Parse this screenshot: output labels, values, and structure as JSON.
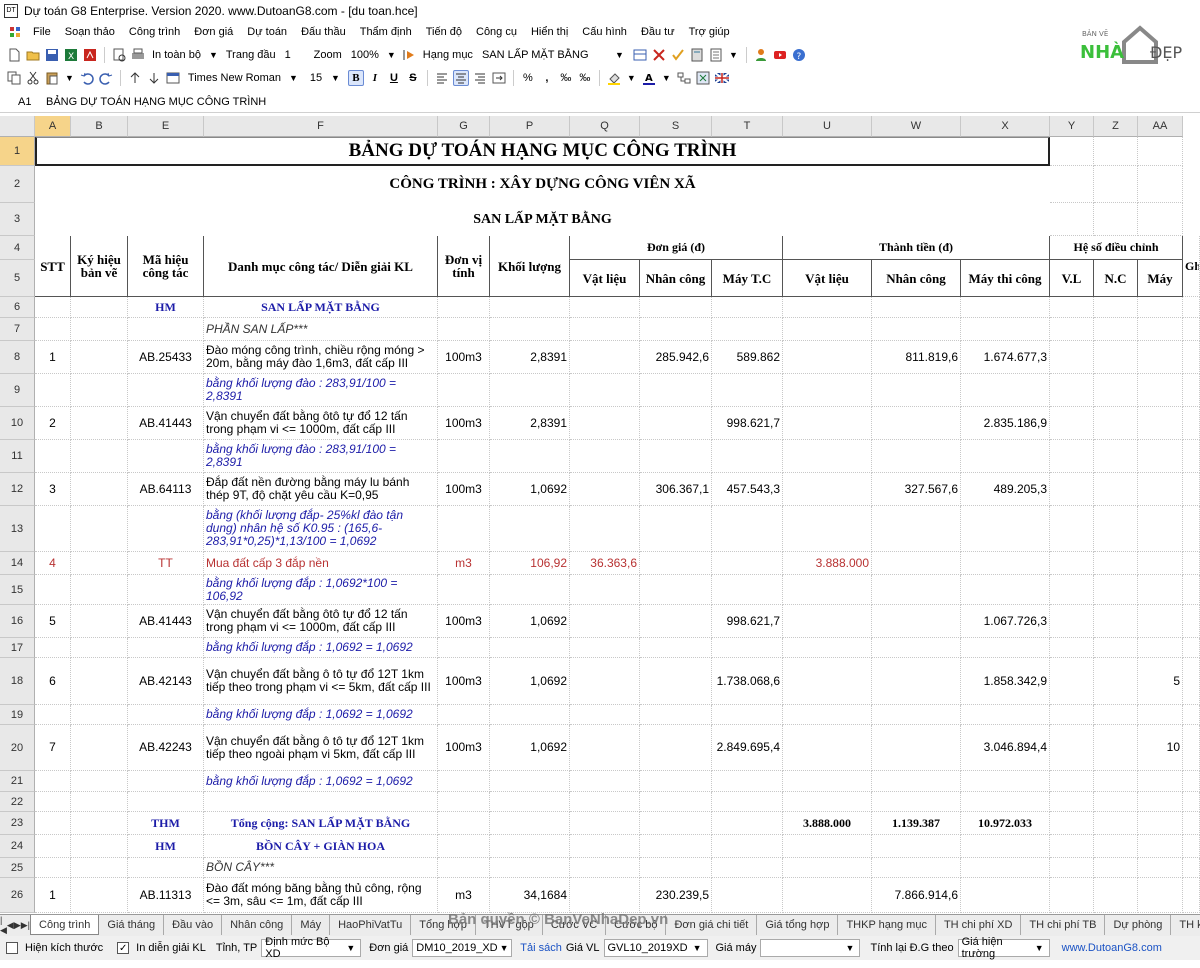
{
  "window": {
    "title": "Dự toán G8 Enterprise. Version 2020.  www.DutoanG8.com - [du toan.hce]"
  },
  "menu": [
    "File",
    "Soạn thảo",
    "Công trình",
    "Đơn giá",
    "Dự toán",
    "Đấu thầu",
    "Thẩm định",
    "Tiến độ",
    "Công cụ",
    "Hiển thị",
    "Cấu hình",
    "Đầu tư",
    "Trợ giúp"
  ],
  "toolbar1": {
    "print_range": "In toàn bộ",
    "page_label": "Trang đầu",
    "page_value": "1",
    "zoom_label": "Zoom",
    "zoom_value": "100%",
    "hm_label": "Hạng mục",
    "hm_value": "SAN LẤP MẶT BẰNG"
  },
  "toolbar2": {
    "font": "Times New Roman",
    "size": "15",
    "bold": "B",
    "italic": "I",
    "underline": "U",
    "strike": "S",
    "percent": "%",
    "comma": ",",
    "dec_up": "‰",
    "dec_down": "‰"
  },
  "logo": {
    "top": "BẢN VẼ",
    "main": "NHÀ",
    "suffix": "ĐẸP"
  },
  "formula": {
    "ref": "A1",
    "value": "BẢNG DỰ TOÁN HẠNG MỤC CÔNG TRÌNH"
  },
  "columns": [
    "A",
    "B",
    "E",
    "F",
    "G",
    "P",
    "Q",
    "S",
    "T",
    "U",
    "W",
    "X",
    "Y",
    "Z",
    "AA"
  ],
  "rows_labels": [
    "1",
    "2",
    "3",
    "4",
    "5",
    "6",
    "7",
    "8",
    "9",
    "10",
    "11",
    "12",
    "13",
    "14",
    "15",
    "16",
    "17",
    "18",
    "19",
    "20",
    "21",
    "22",
    "23",
    "24",
    "25",
    "26"
  ],
  "title": "BẢNG DỰ TOÁN HẠNG MỤC CÔNG TRÌNH",
  "project": "CÔNG TRÌNH : XÂY DỰNG CÔNG VIÊN XÃ",
  "section": "SAN LẤP MẶT BẰNG",
  "headers": {
    "stt": "STT",
    "ky_hieu": "Ký hiệu bản vẽ",
    "ma_hieu": "Mã hiệu công tác",
    "danh_muc": "Danh mục công tác/ Diễn giải KL",
    "don_vi": "Đơn vị tính",
    "khoi_luong": "Khối lượng",
    "don_gia": "Đơn giá (đ)",
    "vat_lieu": "Vật liệu",
    "nhan_cong": "Nhân công",
    "may_tc": "Máy T.C",
    "thanh_tien": "Thành tiền (đ)",
    "vat_lieu2": "Vật liệu",
    "nhan_cong2": "Nhân công",
    "may_thi_cong": "Máy thi công",
    "he_so": "Hệ số điều chỉnh",
    "vl": "V.L",
    "nc": "N.C",
    "may": "Máy",
    "gh": "Gh"
  },
  "rows": [
    {
      "a": "",
      "e": "HM",
      "f": "SAN LẤP MẶT BẰNG",
      "type": "hm"
    },
    {
      "f": "PHẦN SAN LẤP***",
      "type": "note"
    },
    {
      "a": "1",
      "e": "AB.25433",
      "f": "Đào móng công trình, chiều rộng móng > 20m, bằng máy đào 1,6m3, đất cấp III",
      "g": "100m3",
      "p": "2,8391",
      "s": "285.942,6",
      "t": "589.862",
      "w": "811.819,6",
      "x": "1.674.677,3"
    },
    {
      "f": "bằng khối lượng đào : 283,91/100 = 2,8391",
      "type": "expl"
    },
    {
      "a": "2",
      "e": "AB.41443",
      "f": "Vận chuyển đất bằng ôtô tự đổ 12 tấn trong phạm vi <= 1000m, đất cấp III",
      "g": "100m3",
      "p": "2,8391",
      "t": "998.621,7",
      "x": "2.835.186,9"
    },
    {
      "f": "bằng khối lượng đào : 283,91/100 = 2,8391",
      "type": "expl"
    },
    {
      "a": "3",
      "e": "AB.64113",
      "f": "Đắp đất nền đường bằng máy lu bánh thép 9T, độ chặt yêu cầu K=0,95",
      "g": "100m3",
      "p": "1,0692",
      "s": "306.367,1",
      "t": "457.543,3",
      "w": "327.567,6",
      "x": "489.205,3"
    },
    {
      "f": "bằng (khối lượng đắp- 25%kl đào tận dụng) nhân hệ số K0.95 : (165,6-283,91*0,25)*1,13/100 = 1,0692",
      "type": "expl"
    },
    {
      "a": "4",
      "e": "TT",
      "f": "Mua đất cấp 3 đắp nền",
      "g": "m3",
      "p": "106,92",
      "q": "36.363,6",
      "u": "3.888.000",
      "type": "red"
    },
    {
      "f": "bằng khối lượng đắp : 1,0692*100 = 106,92",
      "type": "expl"
    },
    {
      "a": "5",
      "e": "AB.41443",
      "f": "Vận chuyển đất bằng ôtô tự đổ 12 tấn trong phạm vi <= 1000m, đất cấp III",
      "g": "100m3",
      "p": "1,0692",
      "t": "998.621,7",
      "x": "1.067.726,3"
    },
    {
      "f": "bằng khối lượng đắp : 1,0692 = 1,0692",
      "type": "expl"
    },
    {
      "a": "6",
      "e": "AB.42143",
      "f": "Vận chuyển đất bằng ô tô tự đổ 12T 1km tiếp theo trong phạm vi <= 5km, đất cấp III",
      "g": "100m3",
      "p": "1,0692",
      "t": "1.738.068,6",
      "x": "1.858.342,9",
      "aa": "5"
    },
    {
      "f": "bằng khối lượng đắp : 1,0692 = 1,0692",
      "type": "expl"
    },
    {
      "a": "7",
      "e": "AB.42243",
      "f": "Vận chuyển đất bằng ô tô tự đổ 12T 1km tiếp theo ngoài phạm vi 5km, đất cấp III",
      "g": "100m3",
      "p": "1,0692",
      "t": "2.849.695,4",
      "x": "3.046.894,4",
      "aa": "10"
    },
    {
      "f": "bằng khối lượng đắp : 1,0692 = 1,0692",
      "type": "expl"
    },
    {
      "type": "blank"
    },
    {
      "e": "THM",
      "f": "Tổng cộng: SAN LẤP MẶT BẰNG",
      "u": "3.888.000",
      "w": "1.139.387",
      "x": "10.972.033",
      "type": "thm"
    },
    {
      "e": "HM",
      "f": "BỒN CÂY + GIÀN HOA",
      "type": "hm"
    },
    {
      "f": "BỒN CÂY***",
      "type": "note"
    },
    {
      "a": "1",
      "e": "AB.11313",
      "f": "Đào đất móng băng bằng thủ công, rộng <= 3m, sâu <= 1m, đất cấp III",
      "g": "m3",
      "p": "34,1684",
      "s": "230.239,5",
      "w": "7.866.914,6"
    }
  ],
  "tabs": [
    "Công trình",
    "Giá tháng",
    "Đầu vào",
    "Nhân công",
    "Máy",
    "HaoPhiVatTu",
    "Tổng hợp",
    "THVT gộp",
    "Cước VC",
    "Cước bộ",
    "Đơn giá chi tiết",
    "Giá tổng hợp",
    "THKP hạng mục",
    "TH chi phí XD",
    "TH chi phí TB",
    "Dự phòng",
    "TH k"
  ],
  "watermark": "Bản quyền © BanVeNhaDep.vn",
  "status": {
    "hien_kich_thuoc": "Hiện kích thước",
    "in_dien_giai": "In diễn giải KL",
    "tinh_tp": "Tỉnh, TP",
    "dinh_muc": "Định mức Bộ XD",
    "don_gia_label": "Đơn giá",
    "don_gia_value": "DM10_2019_XD",
    "tai_sach": "Tải sách",
    "gia_vl_label": "Giá VL",
    "gia_vl_value": "GVL10_2019XD",
    "gia_may_label": "Giá máy",
    "gia_may_value": "",
    "tinh_lai_label": "Tính lại Đ.G theo",
    "tinh_lai_value": "Giá hiện trường",
    "site": "www.DutoanG8.com"
  }
}
